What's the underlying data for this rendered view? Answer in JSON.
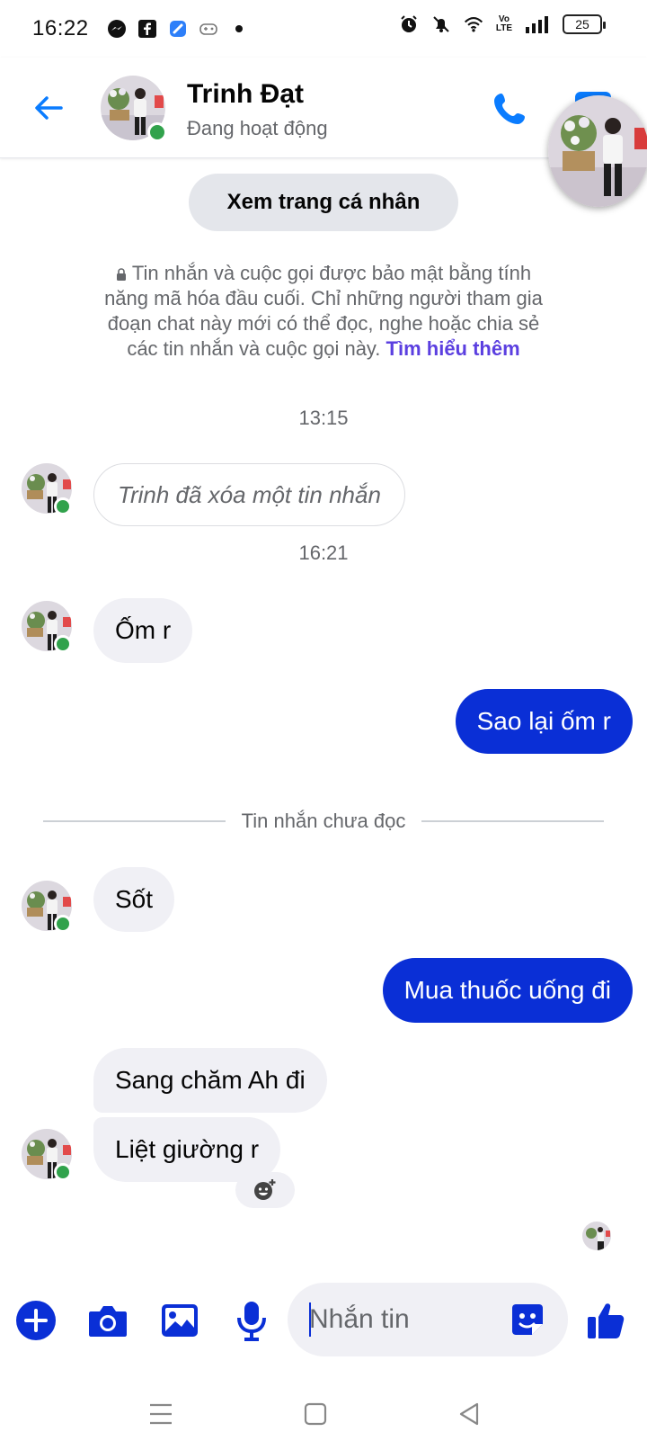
{
  "status_bar": {
    "time": "16:22",
    "battery": "25",
    "volte_top": "Vo",
    "volte_bottom": "LTE"
  },
  "header": {
    "contact_name": "Trinh Đạt",
    "contact_status": "Đang hoạt động"
  },
  "profile_button_label": "Xem trang cá nhân",
  "e2e_notice": {
    "text": "Tin nhắn và cuộc gọi được bảo mật bằng tính năng mã hóa đầu cuối. Chỉ những người tham gia đoạn chat này mới có thể đọc, nghe hoặc chia sẻ các tin nhắn và cuộc gọi này.",
    "link": "Tìm hiểu thêm"
  },
  "thread": {
    "timestamp_1": "13:15",
    "deleted_message": "Trinh đã xóa một tin nhắn",
    "timestamp_2": "16:21",
    "msg_in_1": "Ốm r",
    "msg_out_1": "Sao lại ốm r",
    "unread_label": "Tin nhắn chưa đọc",
    "msg_in_2": "Sốt",
    "msg_out_2": "Mua thuốc uống đi",
    "msg_in_3": "Sang chăm Ah đi",
    "msg_in_4": "Liệt giường r"
  },
  "composer": {
    "placeholder": "Nhắn tin"
  },
  "colors": {
    "accent": "#0a7cff",
    "outgoing_bubble": "#0a2fd6",
    "incoming_bubble": "#f0f0f5",
    "online_dot": "#31a24c",
    "link": "#5b3fe0"
  }
}
